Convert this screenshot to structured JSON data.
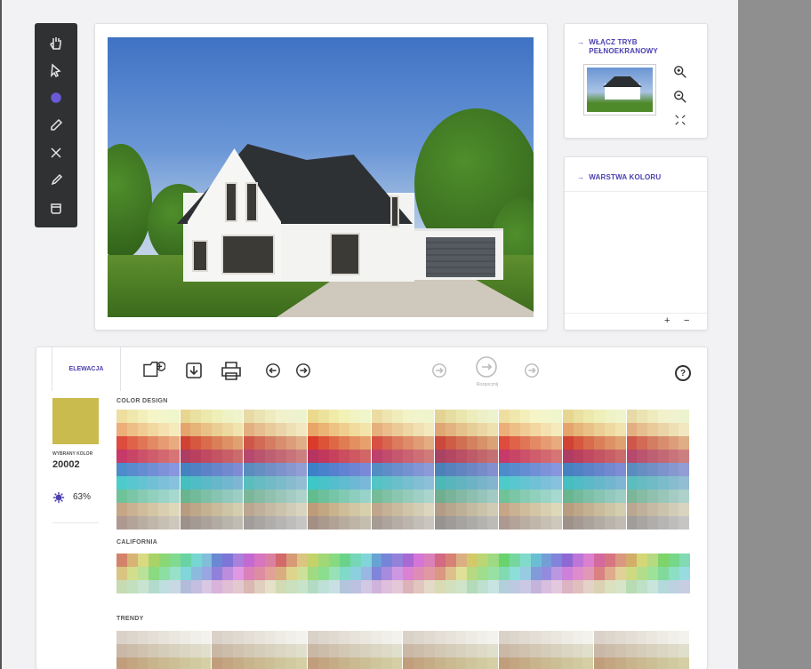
{
  "tools": [
    "hand-icon",
    "pointer-icon",
    "brush-icon",
    "pencil-icon",
    "close-icon",
    "eyedropper-icon",
    "bucket-icon"
  ],
  "fullscreen": {
    "label": "WŁĄCZ TRYB PEŁNOEKRANOWY"
  },
  "layers": {
    "label": "WARSTWA KOLORU",
    "add": "+",
    "remove": "−"
  },
  "tab": {
    "label": "ELEWACJA"
  },
  "center_button": {
    "label": "Rozpocznij"
  },
  "help": {
    "label": "?"
  },
  "selected": {
    "label": "WYBRANY KOLOR",
    "code": "20002",
    "brightness": "63%",
    "color": "#c9bb4e"
  },
  "palettes": {
    "color_design": "COLOR DESIGN",
    "california": "CALIFORNIA",
    "trendy": "TRENDY"
  },
  "accent": "#4a3fb0"
}
